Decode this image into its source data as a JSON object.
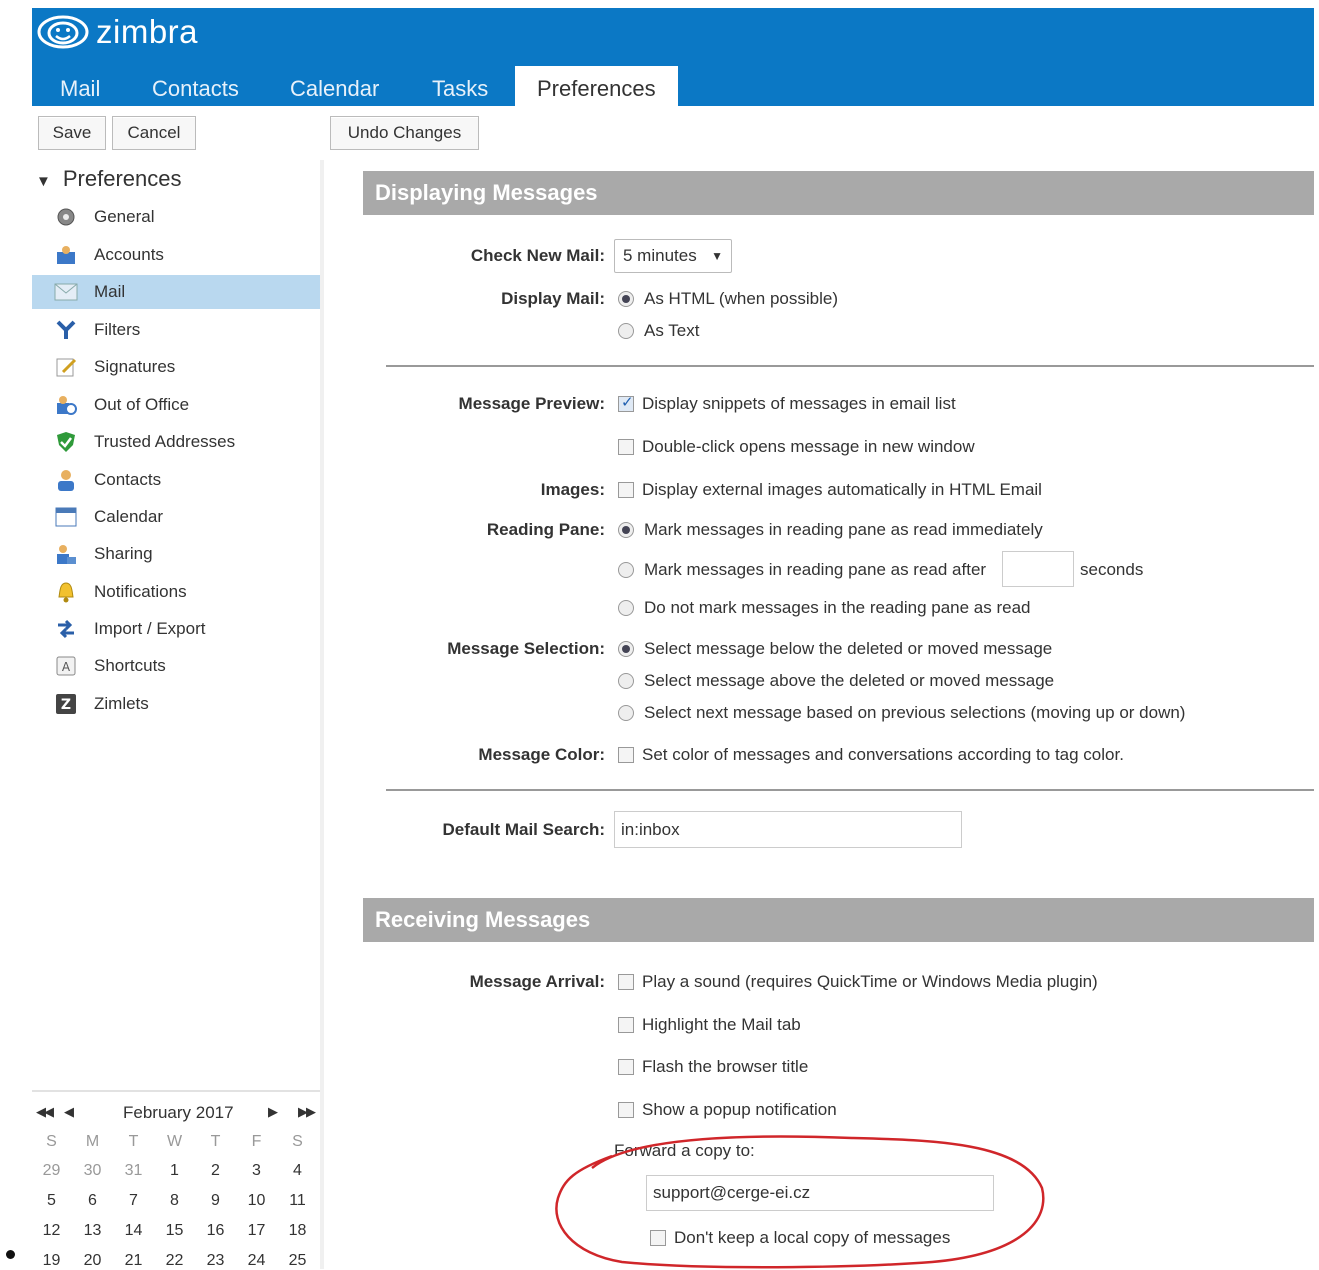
{
  "app": {
    "logo_text": "zimbra",
    "brand_color": "#0b78c5"
  },
  "tabs": [
    "Mail",
    "Contacts",
    "Calendar",
    "Tasks",
    "Preferences"
  ],
  "toolbar": {
    "save_label": "Save",
    "cancel_label": "Cancel",
    "undo_label": "Undo Changes"
  },
  "sidebar": {
    "title": "Preferences",
    "items": [
      {
        "label": "General",
        "icon": "gear-icon"
      },
      {
        "label": "Accounts",
        "icon": "accounts-icon"
      },
      {
        "label": "Mail",
        "icon": "mail-icon",
        "selected": true
      },
      {
        "label": "Filters",
        "icon": "filter-icon"
      },
      {
        "label": "Signatures",
        "icon": "signature-icon"
      },
      {
        "label": "Out of Office",
        "icon": "out-of-office-icon"
      },
      {
        "label": "Trusted Addresses",
        "icon": "shield-icon"
      },
      {
        "label": "Contacts",
        "icon": "contact-icon"
      },
      {
        "label": "Calendar",
        "icon": "calendar-icon"
      },
      {
        "label": "Sharing",
        "icon": "sharing-icon"
      },
      {
        "label": "Notifications",
        "icon": "bell-icon"
      },
      {
        "label": "Import / Export",
        "icon": "import-export-icon"
      },
      {
        "label": "Shortcuts",
        "icon": "keyboard-icon"
      },
      {
        "label": "Zimlets",
        "icon": "zimlet-icon"
      }
    ]
  },
  "mini_calendar": {
    "month": "February 2017",
    "weekdays": [
      "S",
      "M",
      "T",
      "W",
      "T",
      "F",
      "S"
    ],
    "weeks": [
      [
        "29",
        "30",
        "31",
        "1",
        "2",
        "3",
        "4"
      ],
      [
        "5",
        "6",
        "7",
        "8",
        "9",
        "10",
        "11"
      ],
      [
        "12",
        "13",
        "14",
        "15",
        "16",
        "17",
        "18"
      ],
      [
        "19",
        "20",
        "21",
        "22",
        "23",
        "24",
        "25"
      ]
    ]
  },
  "displaying": {
    "section_title": "Displaying Messages",
    "check_new_mail_label": "Check New Mail:",
    "check_new_mail_value": "5 minutes",
    "display_mail_label": "Display Mail:",
    "display_html": "As HTML (when possible)",
    "display_text": "As Text",
    "message_preview_label": "Message Preview:",
    "snippets": "Display snippets of messages in email list",
    "double_click": "Double-click opens message in new window",
    "images_label": "Images:",
    "external_images": "Display external images automatically in HTML Email",
    "reading_pane_label": "Reading Pane:",
    "rp_immediate": "Mark messages in reading pane as read immediately",
    "rp_after": "Mark messages in reading pane as read after",
    "rp_seconds": "seconds",
    "rp_never": "Do not mark messages in the reading pane as read",
    "message_selection_label": "Message Selection:",
    "sel_below": "Select message below the deleted or moved message",
    "sel_above": "Select message above the deleted or moved message",
    "sel_next": "Select next message based on previous selections (moving up or down)",
    "message_color_label": "Message Color:",
    "color_tag": "Set color of messages and conversations according to tag color.",
    "default_search_label": "Default Mail Search:",
    "default_search_value": "in:inbox"
  },
  "receiving": {
    "section_title": "Receiving Messages",
    "arrival_label": "Message Arrival:",
    "play_sound": "Play a sound (requires QuickTime or Windows Media plugin)",
    "highlight_tab": "Highlight the Mail tab",
    "flash_title": "Flash the browser title",
    "popup": "Show a popup notification",
    "forward_label": "Forward a copy to:",
    "forward_value": "support@cerge-ei.cz",
    "no_local_copy": "Don't keep a local copy of messages"
  },
  "annotation_color": "#d0262a"
}
